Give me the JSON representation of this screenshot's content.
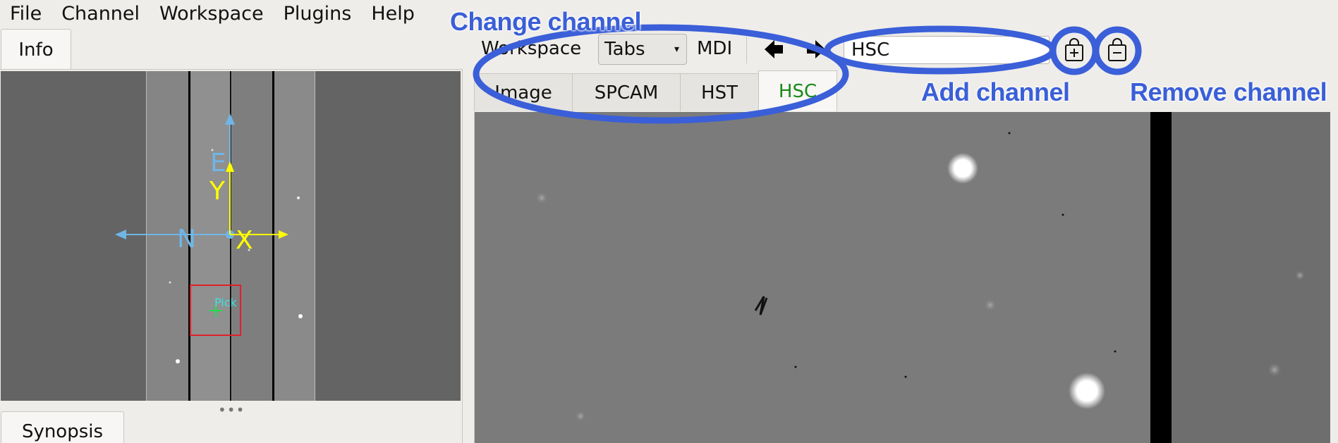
{
  "menubar": {
    "items": [
      "File",
      "Channel",
      "Workspace",
      "Plugins",
      "Help"
    ]
  },
  "left_panel": {
    "info_tab": "Info",
    "synopsis_tab": "Synopsis",
    "splitter": "•••"
  },
  "thumbnail": {
    "compass": {
      "east": "E",
      "north": "N",
      "y_axis": "Y",
      "x_axis": "X"
    },
    "pick_label": "Pick",
    "compass_color": "#6fb6e6",
    "axis_color": "#ffff00",
    "pick_box_color": "#e0202a",
    "pick_label_color": "#3fe0e0"
  },
  "toolbar": {
    "workspace_label": "Workspace",
    "workspace_value": "Tabs",
    "mdi_label": "MDI",
    "channel_value": "HSC",
    "add_channel_icon": "add-channel-icon",
    "remove_channel_icon": "remove-channel-icon"
  },
  "channel_tabs": [
    {
      "label": "Image",
      "active": false
    },
    {
      "label": "SPCAM",
      "active": false
    },
    {
      "label": "HST",
      "active": false
    },
    {
      "label": "HSC",
      "active": true
    }
  ],
  "annotations": {
    "change_channel": "Change channel",
    "add_channel": "Add channel",
    "remove_channel": "Remove channel",
    "color": "#3a5fd8"
  }
}
